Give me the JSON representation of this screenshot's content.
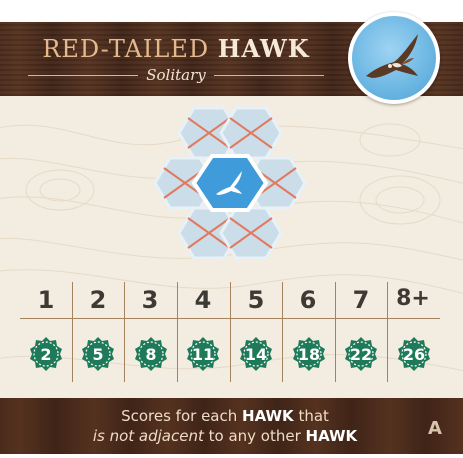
{
  "card": {
    "title_prefix": "RED-TAILED ",
    "title_strong": "HAWK",
    "subtitle": "Solitary",
    "badge_icon": "hawk-in-sky-icon",
    "diagram": {
      "center_icon": "hawk-icon",
      "neighbor_marker": "red-x-icon",
      "colors": {
        "hex_light": "#cbdde9",
        "hex_center": "#3f9bd9",
        "cross": "#e07a5f"
      }
    },
    "scoring": {
      "counts": [
        "1",
        "2",
        "3",
        "4",
        "5",
        "6",
        "7",
        "8+"
      ],
      "points": [
        "2",
        "5",
        "8",
        "11",
        "14",
        "18",
        "22",
        "26"
      ],
      "seal_color": "#1f7a5a"
    },
    "footer": {
      "line1_prefix": "Scores for each ",
      "line1_emphasis": "HAWK",
      "line1_suffix": " that",
      "line2_italic": "is not adjacent",
      "line2_middle": " to any other ",
      "line2_emphasis": "HAWK"
    },
    "variant_letter": "A",
    "colors": {
      "wood": "#4a2b1c",
      "paper": "#f3ece0",
      "title_accent": "#e4b98c"
    }
  }
}
